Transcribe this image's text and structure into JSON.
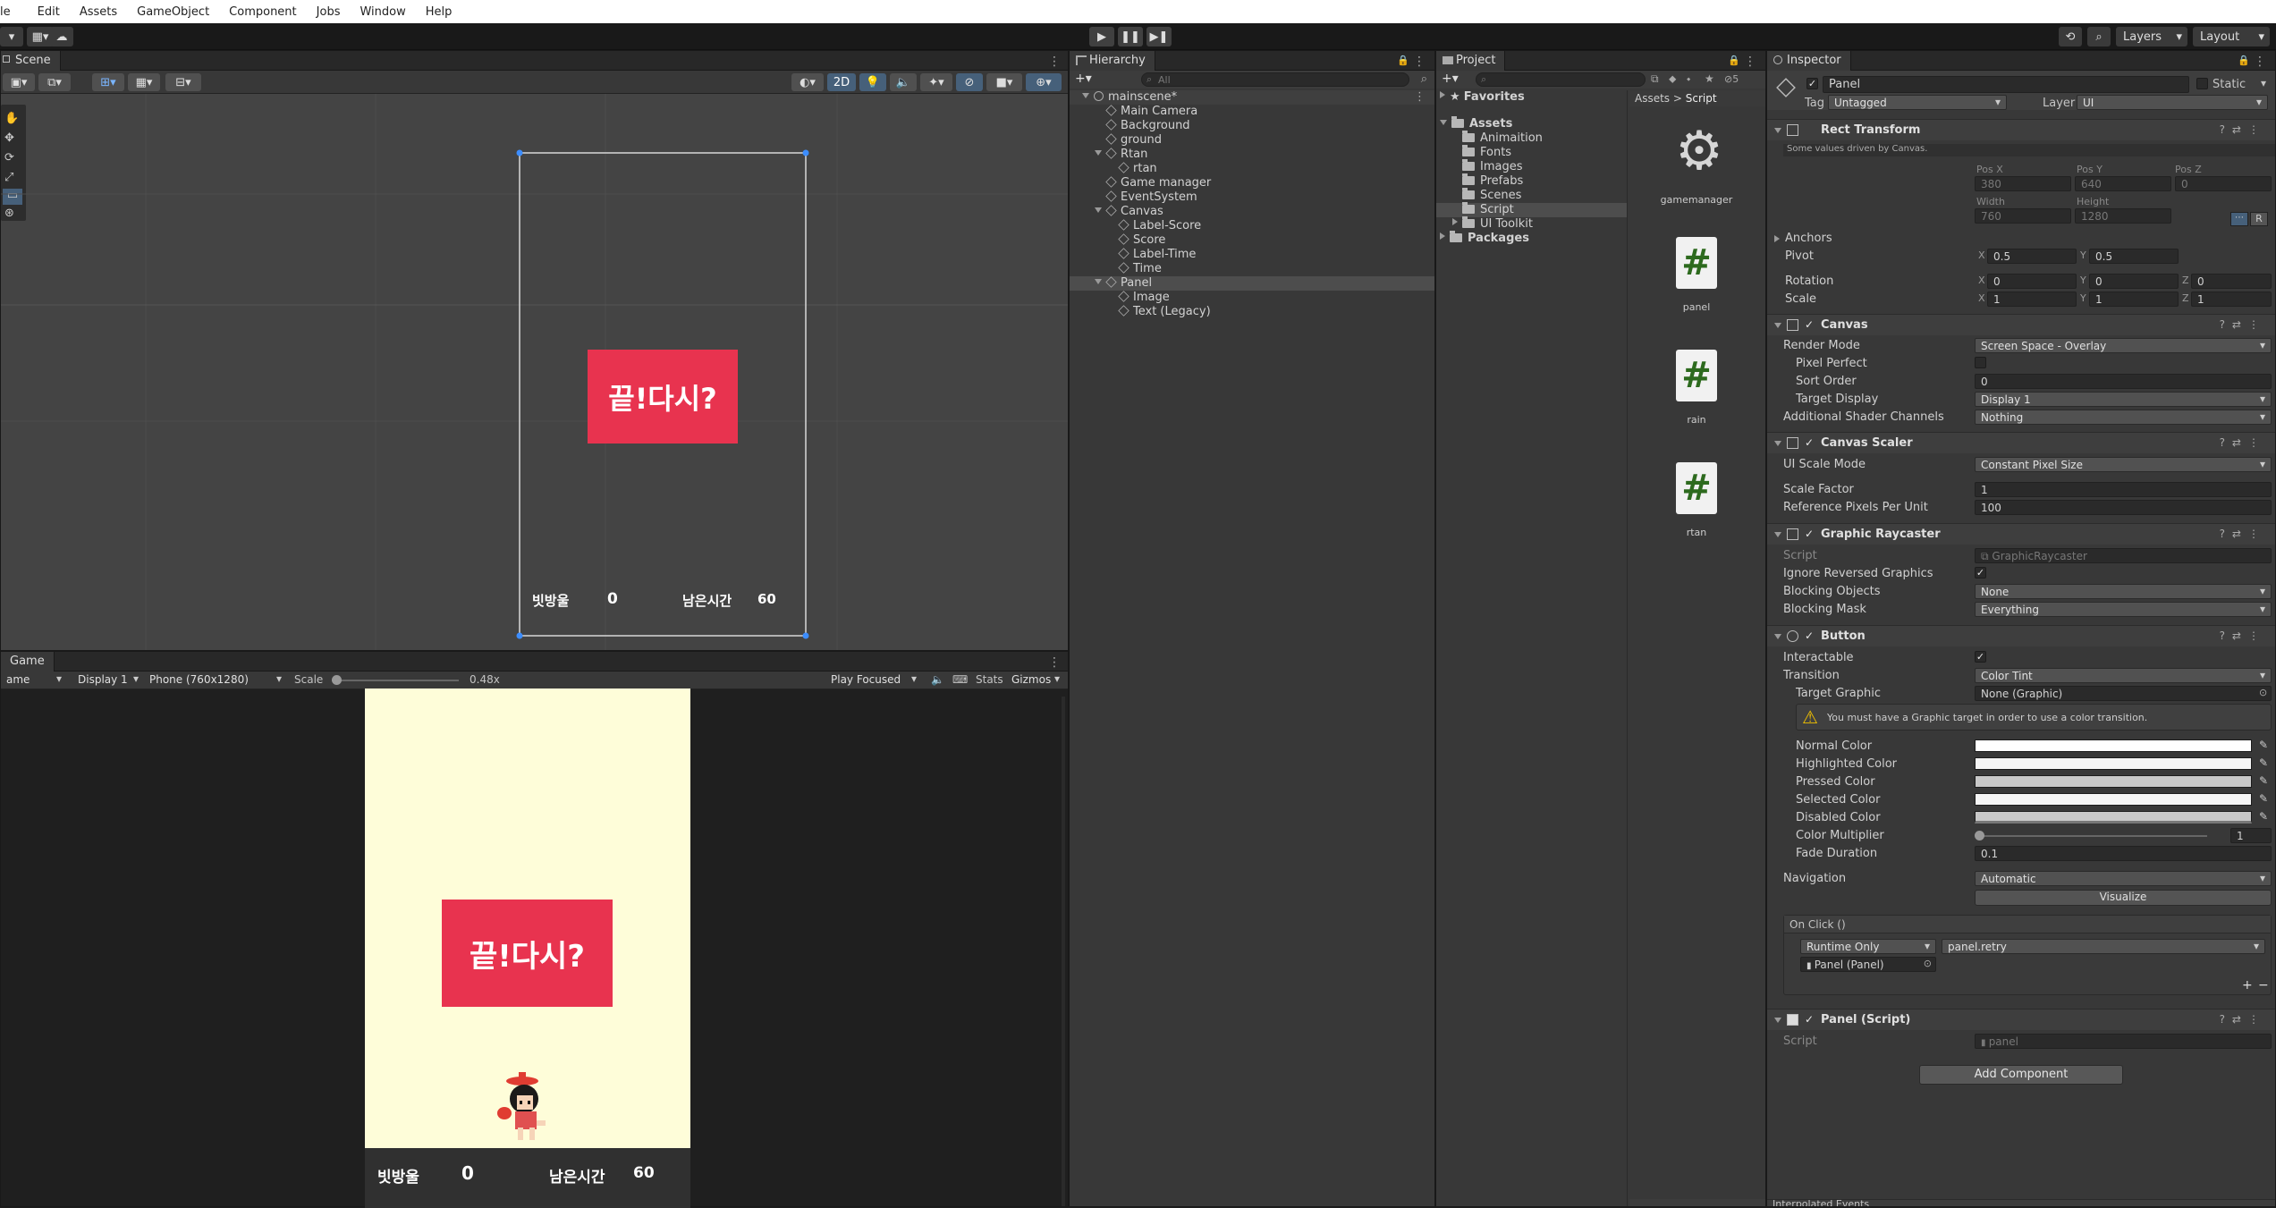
{
  "menubar": {
    "items": [
      "le",
      "Edit",
      "Assets",
      "GameObject",
      "Component",
      "Jobs",
      "Window",
      "Help"
    ]
  },
  "toolbar": {
    "right_buttons": {
      "layers": "Layers",
      "layout": "Layout"
    }
  },
  "scene": {
    "tab": "Scene",
    "mode_2d": "2D",
    "canvas_button": "끝!다시?",
    "score_label": "빗방울",
    "score_value": "0",
    "time_label": "남은시간",
    "time_value": "60"
  },
  "game": {
    "tab": "Game",
    "mode": "ame",
    "display": "Display 1",
    "resolution": "Phone (760x1280)",
    "scale_label": "Scale",
    "scale_value": "0.48x",
    "play_focused": "Play Focused",
    "stats": "Stats",
    "gizmos": "Gizmos",
    "button_text": "끝!다시?",
    "score_label": "빗방울",
    "score_value": "0",
    "time_label": "남은시간",
    "time_value": "60"
  },
  "hierarchy": {
    "tab": "Hierarchy",
    "search_placeholder": "All",
    "items": [
      {
        "label": "mainscene*",
        "depth": 0,
        "type": "scene",
        "expanded": true
      },
      {
        "label": "Main Camera",
        "depth": 1,
        "type": "go"
      },
      {
        "label": "Background",
        "depth": 1,
        "type": "go"
      },
      {
        "label": "ground",
        "depth": 1,
        "type": "go"
      },
      {
        "label": "Rtan",
        "depth": 1,
        "type": "go",
        "expanded": true
      },
      {
        "label": "rtan",
        "depth": 2,
        "type": "go"
      },
      {
        "label": "Game manager",
        "depth": 1,
        "type": "go"
      },
      {
        "label": "EventSystem",
        "depth": 1,
        "type": "go"
      },
      {
        "label": "Canvas",
        "depth": 1,
        "type": "go",
        "expanded": true
      },
      {
        "label": "Label-Score",
        "depth": 2,
        "type": "go"
      },
      {
        "label": "Score",
        "depth": 2,
        "type": "go"
      },
      {
        "label": "Label-Time",
        "depth": 2,
        "type": "go"
      },
      {
        "label": "Time",
        "depth": 2,
        "type": "go"
      },
      {
        "label": "Panel",
        "depth": 1,
        "type": "go",
        "expanded": true,
        "selected": true
      },
      {
        "label": "Image",
        "depth": 2,
        "type": "go"
      },
      {
        "label": "Text (Legacy)",
        "depth": 2,
        "type": "go"
      }
    ]
  },
  "project": {
    "tab": "Project",
    "tree": [
      {
        "label": "Favorites",
        "depth": 0,
        "bold": true,
        "icon": "star"
      },
      {
        "label": "Assets",
        "depth": 0,
        "bold": true,
        "expanded": true
      },
      {
        "label": "Animaition",
        "depth": 1
      },
      {
        "label": "Fonts",
        "depth": 1
      },
      {
        "label": "Images",
        "depth": 1
      },
      {
        "label": "Prefabs",
        "depth": 1
      },
      {
        "label": "Scenes",
        "depth": 1
      },
      {
        "label": "Script",
        "depth": 1,
        "selected": true
      },
      {
        "label": "UI Toolkit",
        "depth": 1,
        "collapsed": true
      },
      {
        "label": "Packages",
        "depth": 0,
        "bold": true,
        "collapsed": true
      }
    ],
    "breadcrumb": [
      "Assets",
      ">",
      "Script"
    ],
    "assets": [
      {
        "name": "gamemanager",
        "icon": "gear-icon"
      },
      {
        "name": "panel",
        "icon": "script-icon"
      },
      {
        "name": "rain",
        "icon": "script-icon"
      },
      {
        "name": "rtan",
        "icon": "script-icon"
      }
    ],
    "hidden_count": "5"
  },
  "inspector": {
    "tab": "Inspector",
    "object_name": "Panel",
    "static_label": "Static",
    "tag_label": "Tag",
    "tag_value": "Untagged",
    "layer_label": "Layer",
    "layer_value": "UI",
    "rect_transform": {
      "title": "Rect Transform",
      "note": "Some values driven by Canvas.",
      "pos_x_label": "Pos X",
      "pos_y_label": "Pos Y",
      "pos_z_label": "Pos Z",
      "pos_x": "380",
      "pos_y": "640",
      "pos_z": "0",
      "width_label": "Width",
      "height_label": "Height",
      "width": "760",
      "height": "1280",
      "anchors": "Anchors",
      "pivot": "Pivot",
      "pivot_x": "0.5",
      "pivot_y": "0.5",
      "rotation": "Rotation",
      "rot_x": "0",
      "rot_y": "0",
      "rot_z": "0",
      "scale": "Scale",
      "scale_x": "1",
      "scale_y": "1",
      "scale_z": "1",
      "r_button": "R"
    },
    "canvas": {
      "title": "Canvas",
      "render_mode_label": "Render Mode",
      "render_mode": "Screen Space - Overlay",
      "pixel_perfect_label": "Pixel Perfect",
      "sort_order_label": "Sort Order",
      "sort_order": "0",
      "target_display_label": "Target Display",
      "target_display": "Display 1",
      "shader_channels_label": "Additional Shader Channels",
      "shader_channels": "Nothing"
    },
    "canvas_scaler": {
      "title": "Canvas Scaler",
      "ui_scale_mode_label": "UI Scale Mode",
      "ui_scale_mode": "Constant Pixel Size",
      "scale_factor_label": "Scale Factor",
      "scale_factor": "1",
      "ref_ppu_label": "Reference Pixels Per Unit",
      "ref_ppu": "100"
    },
    "graphic_raycaster": {
      "title": "Graphic Raycaster",
      "script_label": "Script",
      "script_value": "GraphicRaycaster",
      "ignore_reversed_label": "Ignore Reversed Graphics",
      "blocking_objects_label": "Blocking Objects",
      "blocking_objects": "None",
      "blocking_mask_label": "Blocking Mask",
      "blocking_mask": "Everything"
    },
    "button": {
      "title": "Button",
      "interactable_label": "Interactable",
      "transition_label": "Transition",
      "transition": "Color Tint",
      "target_graphic_label": "Target Graphic",
      "target_graphic": "None (Graphic)",
      "warning": "You must have a Graphic target in order to use a color transition.",
      "normal_color_label": "Normal Color",
      "highlighted_color_label": "Highlighted Color",
      "pressed_color_label": "Pressed Color",
      "selected_color_label": "Selected Color",
      "disabled_color_label": "Disabled Color",
      "color_multiplier_label": "Color Multiplier",
      "color_multiplier": "1",
      "fade_duration_label": "Fade Duration",
      "fade_duration": "0.1",
      "navigation_label": "Navigation",
      "navigation": "Automatic",
      "visualize": "Visualize",
      "onclick_label": "On Click ()",
      "runtime": "Runtime Only",
      "function": "panel.retry",
      "target_object": "Panel (Panel)"
    },
    "panel_script": {
      "title": "Panel (Script)",
      "script_label": "Script",
      "script_value": "panel"
    },
    "add_component": "Add Component",
    "bottom_tab": "Interpolated Events"
  },
  "colors": {
    "accent_red": "#e8334f",
    "game_bg": "#fefdd9",
    "selection": "#2c5d87"
  }
}
